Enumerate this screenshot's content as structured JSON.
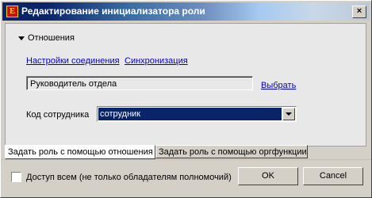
{
  "window": {
    "title": "Редактирование инициализатора роли",
    "close_glyph": "×",
    "app_icon_letter": "E"
  },
  "section": {
    "header": "Отношения"
  },
  "links": {
    "connection_settings": "Настройки соединения",
    "sync": "Синхронизация",
    "choose": "Выбрать"
  },
  "role_field": {
    "value": "Руководитель отдела"
  },
  "employee_code": {
    "label": "Код сотрудника",
    "selected": "сотрудник"
  },
  "tabs": [
    {
      "label": "Задать роль с помощью отношения",
      "active": true
    },
    {
      "label": "Задать роль с помощью оргфункции",
      "active": false
    }
  ],
  "footer": {
    "checkbox_label": "Доступ всем (не только обладателям полномочий)",
    "checked": false,
    "ok_label": "OK",
    "cancel_label": "Cancel"
  }
}
